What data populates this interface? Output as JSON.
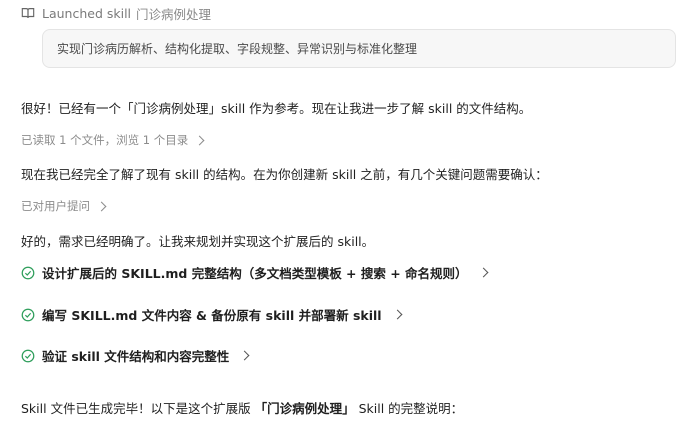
{
  "launch": {
    "prefix": "Launched skill",
    "skill_name": "门诊病例处理",
    "icon": "book-open-icon"
  },
  "skill_description": "实现门诊病历解析、结构化提取、字段规整、异常识别与标准化整理",
  "messages": {
    "intro": "很好！已经有一个「门诊病例处理」skill 作为参考。现在让我进一步了解 skill 的文件结构。",
    "read_status": "已读取 1 个文件，浏览 1 个目录",
    "understood": "现在我已经完全了解了现有 skill 的结构。在为你创建新 skill 之前，有几个关键问题需要确认：",
    "asked_status": "已对用户提问",
    "clarified": "好的，需求已经明确了。让我来规划并实现这个扩展后的 skill。"
  },
  "tasks": [
    {
      "label": "设计扩展后的 SKILL.md 完整结构（多文档类型模板 + 搜索 + 命名规则）",
      "status": "done"
    },
    {
      "label": "编写 SKILL.md 文件内容 & 备份原有 skill 并部署新 skill",
      "status": "done"
    },
    {
      "label": "验证 skill 文件结构和内容完整性",
      "status": "done"
    }
  ],
  "final": {
    "before": "Skill 文件已生成完毕！以下是这个扩展版",
    "highlight": "「门诊病例处理」",
    "after": "Skill 的完整说明："
  },
  "colors": {
    "check_green": "#2e9e5b",
    "muted_text": "#8c8c8c",
    "box_bg": "#f7f7f7"
  }
}
